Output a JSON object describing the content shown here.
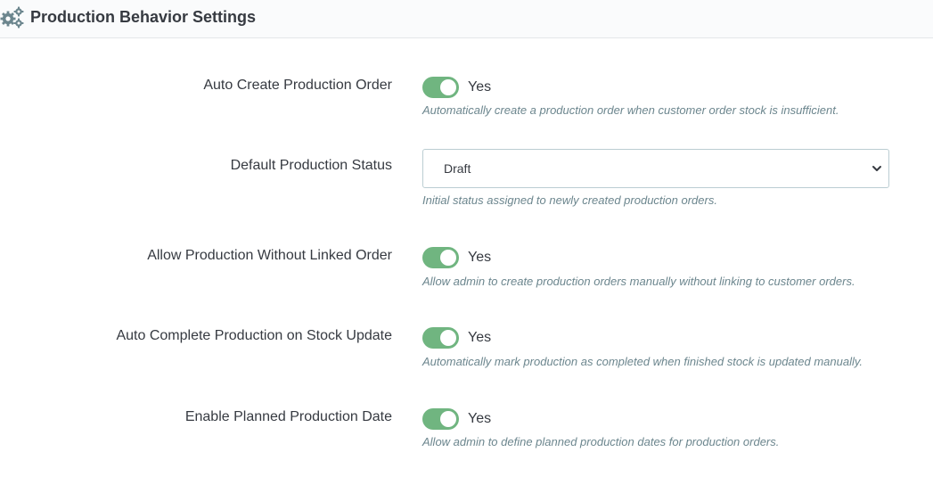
{
  "header": {
    "title": "Production Behavior Settings",
    "icon": "gears-icon"
  },
  "colors": {
    "switch_on": "#70b580",
    "help_text": "#6c868e",
    "text": "#363a41"
  },
  "settings": {
    "auto_create": {
      "label": "Auto Create Production Order",
      "enabled": true,
      "value_label": "Yes",
      "help": "Automatically create a production order when customer order stock is insufficient."
    },
    "default_status": {
      "label": "Default Production Status",
      "selected": "Draft",
      "help": "Initial status assigned to newly created production orders."
    },
    "allow_without_order": {
      "label": "Allow Production Without Linked Order",
      "enabled": true,
      "value_label": "Yes",
      "help": "Allow admin to create production orders manually without linking to customer orders."
    },
    "auto_complete": {
      "label": "Auto Complete Production on Stock Update",
      "enabled": true,
      "value_label": "Yes",
      "help": "Automatically mark production as completed when finished stock is updated manually."
    },
    "planned_date": {
      "label": "Enable Planned Production Date",
      "enabled": true,
      "value_label": "Yes",
      "help": "Allow admin to define planned production dates for production orders."
    }
  }
}
